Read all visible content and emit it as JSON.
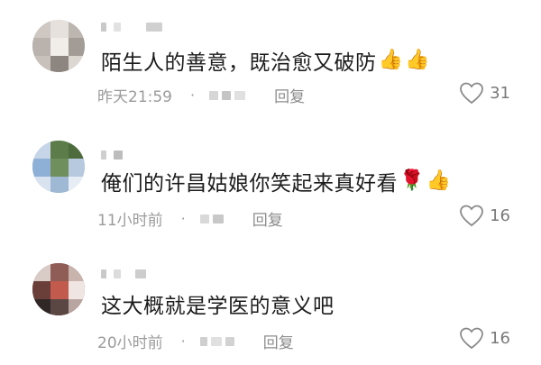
{
  "comments": [
    {
      "text": "陌生人的善意，既治愈又破防",
      "emojis": [
        "👍",
        "👍"
      ],
      "time": "昨天21:59",
      "separator": "·",
      "reply_label": "回复",
      "likes": "31",
      "heart_icon": "heart-outline-icon"
    },
    {
      "text": "俺们的许昌姑娘你笑起来真好看",
      "emojis": [
        "🌹",
        "👍"
      ],
      "time": "11小时前",
      "separator": "·",
      "reply_label": "回复",
      "likes": "16",
      "heart_icon": "heart-outline-icon"
    },
    {
      "text": "这大概就是学医的意义吧",
      "emojis": [],
      "time": "20小时前",
      "separator": "·",
      "reply_label": "回复",
      "likes": "16",
      "heart_icon": "heart-outline-icon"
    }
  ],
  "colors": {
    "text": "#1c1c1c",
    "meta": "#9b9b9b",
    "heart": "#7a7a7a"
  }
}
